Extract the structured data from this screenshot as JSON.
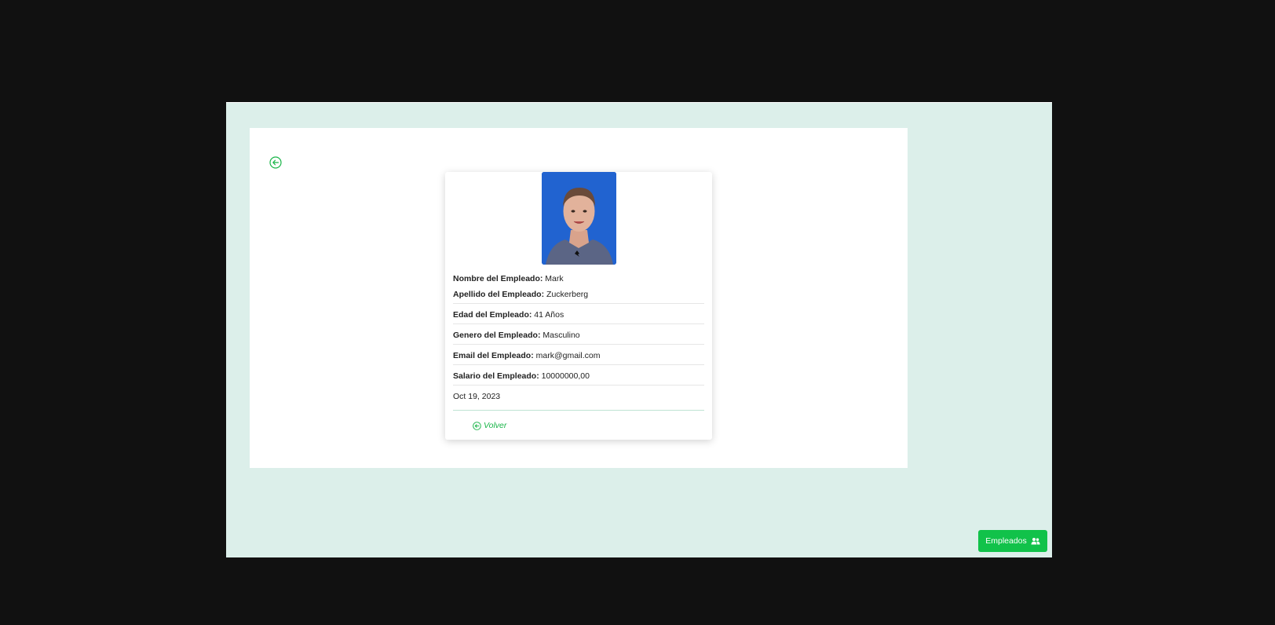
{
  "page": {
    "accent_color": "#1ab549",
    "background_color": "#dcefea"
  },
  "nav": {
    "back_icon": "arrow-left-circle-icon"
  },
  "employee": {
    "photo_icon": "employee-photo",
    "fields": [
      {
        "label": "Nombre del Empleado:",
        "value": "Mark"
      },
      {
        "label": "Apellido del Empleado:",
        "value": "Zuckerberg"
      },
      {
        "label": "Edad del Empleado:",
        "value": "41 Años"
      },
      {
        "label": "Genero del Empleado:",
        "value": "Masculino"
      },
      {
        "label": "Email del Empleado:",
        "value": "mark@gmail.com"
      },
      {
        "label": "Salario del Empleado:",
        "value": "10000000,00"
      }
    ],
    "date": "Oct 19, 2023"
  },
  "actions": {
    "volver_label": "Volver",
    "empleados_label": "Empleados",
    "empleados_icon": "users-icon"
  }
}
